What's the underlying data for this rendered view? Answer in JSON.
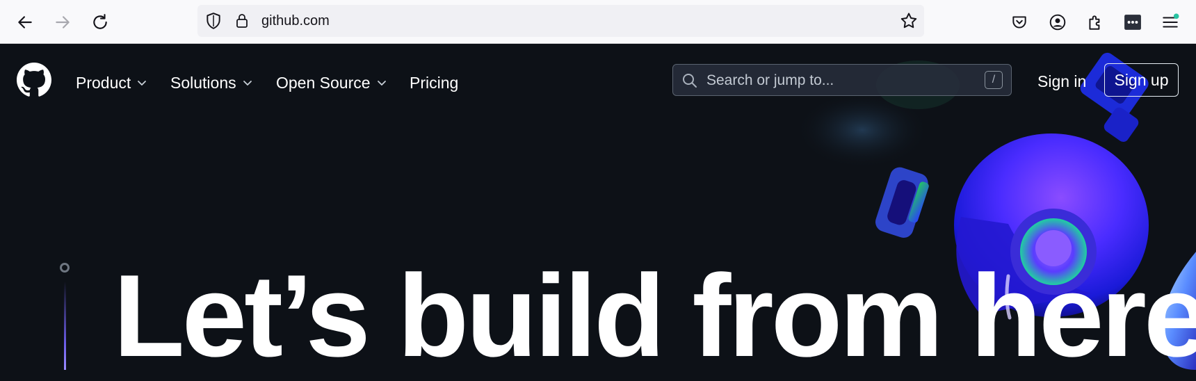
{
  "browser": {
    "url": "github.com",
    "icons": [
      "back-arrow-icon",
      "forward-arrow-icon",
      "reload-icon",
      "shield-icon",
      "lock-icon",
      "bookmark-star-icon",
      "pocket-icon",
      "account-icon",
      "extensions-icon",
      "password-manager-icon",
      "menu-icon"
    ]
  },
  "header": {
    "nav": [
      {
        "label": "Product",
        "has_dropdown": true
      },
      {
        "label": "Solutions",
        "has_dropdown": true
      },
      {
        "label": "Open Source",
        "has_dropdown": true
      },
      {
        "label": "Pricing",
        "has_dropdown": false
      }
    ],
    "search_placeholder": "Search or jump to...",
    "search_shortcut": "/",
    "sign_in": "Sign in",
    "sign_up": "Sign up"
  },
  "hero": {
    "title": "Let’s build from here"
  },
  "colors": {
    "background": "#0d1117",
    "chrome": "#f9f9fb",
    "text": "#ffffff",
    "accent_purple": "#6b5ce7",
    "notification_dot": "#2ac3a2"
  }
}
